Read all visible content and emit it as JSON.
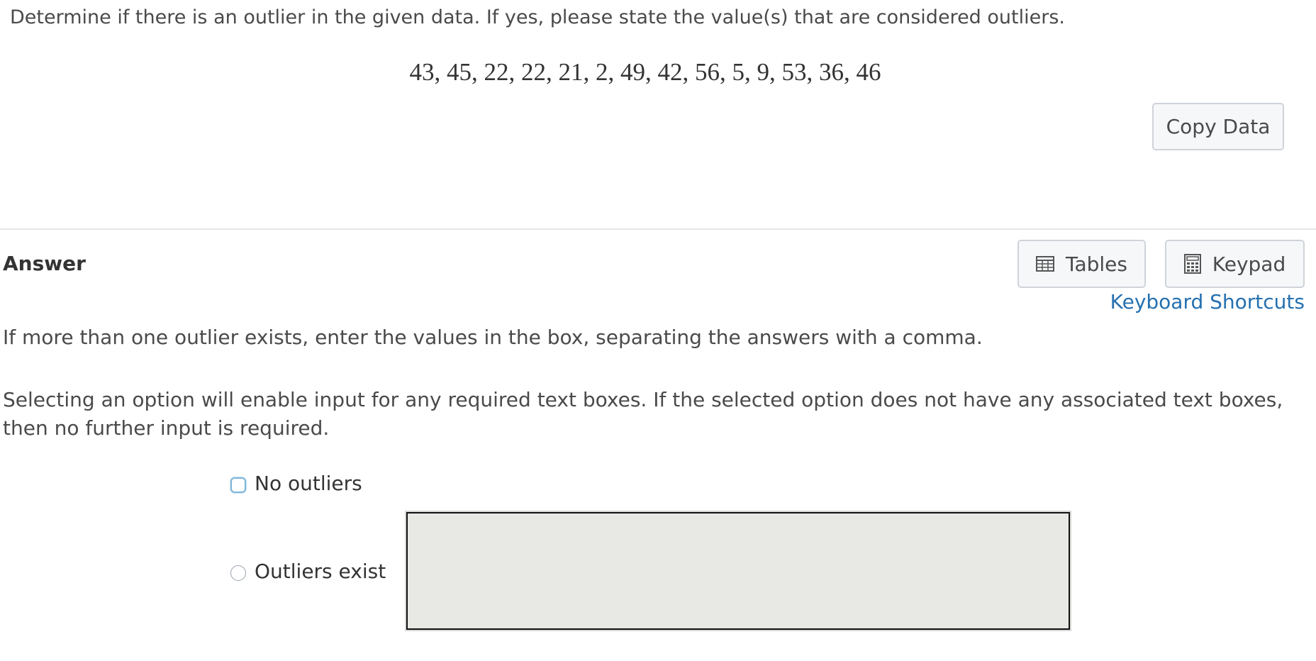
{
  "question": {
    "prompt": "Determine if there is an outlier in the given data. If yes, please state the value(s) that are considered outliers.",
    "data_values": "43, 45, 22, 22, 21, 2, 49, 42, 56, 5, 9, 53, 36, 46",
    "copy_button_label": "Copy Data"
  },
  "answer": {
    "heading": "Answer",
    "tables_button_label": "Tables",
    "keypad_button_label": "Keypad",
    "keyboard_shortcuts_label": "Keyboard Shortcuts",
    "instruction_1": "If more than one outlier exists, enter the values in the box, separating the answers with a comma.",
    "instruction_2": "Selecting an option will enable input for any required text boxes. If the selected option does not have any associated text boxes, then no further input is required.",
    "options": [
      {
        "label": "No outliers"
      },
      {
        "label": "Outliers exist"
      }
    ],
    "input_value": ""
  },
  "icons": {
    "tables": "table-grid-icon",
    "keypad": "calculator-icon"
  },
  "colors": {
    "link": "#2570b0",
    "input_background": "#e8e9e4",
    "button_background": "#f6f7f9",
    "focus_ring": "#7fb6d8"
  }
}
